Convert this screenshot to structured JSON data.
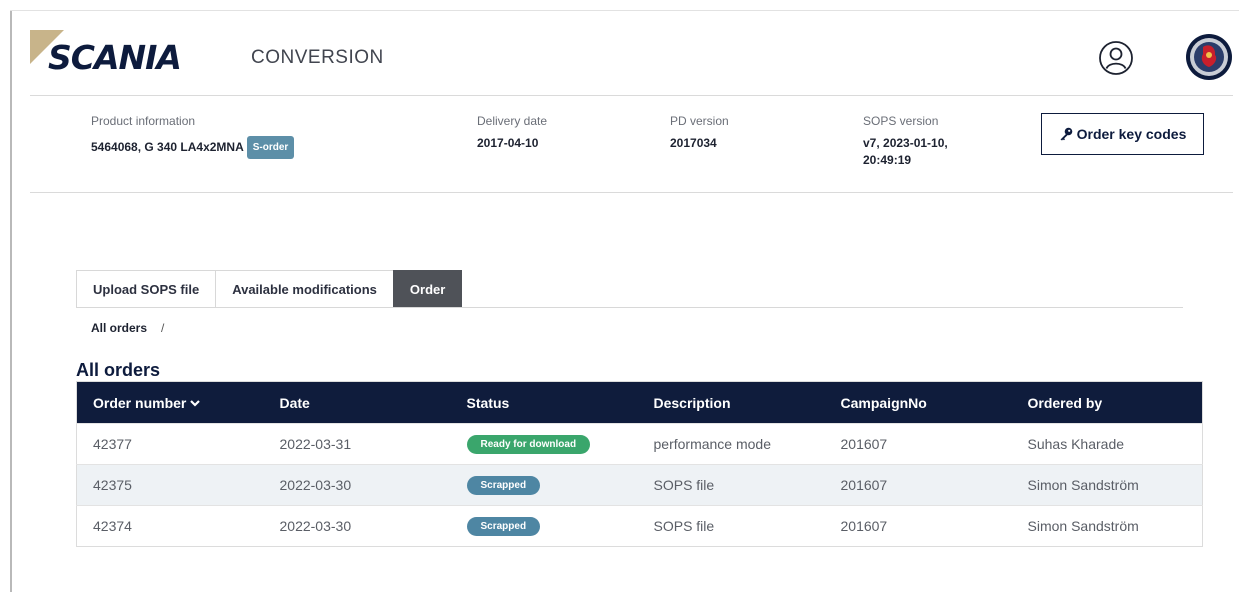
{
  "header": {
    "brand": "SCANIA",
    "app_title": "CONVERSION",
    "profile_icon": "user-circle-icon",
    "emblem_icon": "griffin-emblem-icon"
  },
  "product": {
    "info_label": "Product information",
    "info_value": "5464068, G 340 LA4x2MNA",
    "order_badge": "S-order",
    "delivery_label": "Delivery date",
    "delivery_value": "2017-04-10",
    "pd_label": "PD version",
    "pd_value": "2017034",
    "sops_label": "SOPS version",
    "sops_value_line1": "v7, 2023-01-10,",
    "sops_value_line2": "20:49:19",
    "order_keys_label": "Order key codes",
    "order_keys_icon": "key-icon"
  },
  "tabs": [
    {
      "label": "Upload SOPS file",
      "active": false
    },
    {
      "label": "Available modifications",
      "active": false
    },
    {
      "label": "Order",
      "active": true
    }
  ],
  "breadcrumb": {
    "item": "All orders",
    "separator": "/"
  },
  "section_title": "All orders",
  "table": {
    "headers": [
      "Order number",
      "Date",
      "Status",
      "Description",
      "CampaignNo",
      "Ordered by"
    ],
    "rows": [
      {
        "order": "42377",
        "date": "2022-03-31",
        "status": "Ready for download",
        "status_type": "ready",
        "description": "performance mode",
        "campaign": "201607",
        "ordered_by": "Suhas Kharade"
      },
      {
        "order": "42375",
        "date": "2022-03-30",
        "status": "Scrapped",
        "status_type": "scrapped",
        "description": "SOPS file",
        "campaign": "201607",
        "ordered_by": "Simon Sandström"
      },
      {
        "order": "42374",
        "date": "2022-03-30",
        "status": "Scrapped",
        "status_type": "scrapped",
        "description": "SOPS file",
        "campaign": "201607",
        "ordered_by": "Simon Sandström"
      }
    ]
  },
  "colors": {
    "navy": "#0f1c3c",
    "ready": "#3aa66c",
    "scrapped": "#4e86a3",
    "badge": "#5d8fa8",
    "tab_active": "#4f5258"
  }
}
